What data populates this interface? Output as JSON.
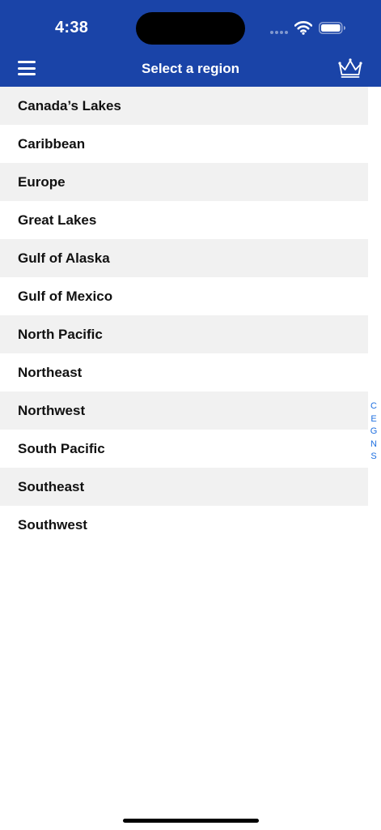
{
  "status_bar": {
    "time": "4:38"
  },
  "header": {
    "title": "Select a region",
    "menu_icon": "hamburger-menu-icon",
    "premium_icon": "crown-icon",
    "background_color": "#1a44a8"
  },
  "regions": [
    {
      "label": "Canada’s Lakes"
    },
    {
      "label": "Caribbean"
    },
    {
      "label": "Europe"
    },
    {
      "label": "Great Lakes"
    },
    {
      "label": "Gulf of Alaska"
    },
    {
      "label": "Gulf of Mexico"
    },
    {
      "label": "North Pacific"
    },
    {
      "label": "Northeast"
    },
    {
      "label": "Northwest"
    },
    {
      "label": "South Pacific"
    },
    {
      "label": "Southeast"
    },
    {
      "label": "Southwest"
    }
  ],
  "section_index": [
    "C",
    "E",
    "G",
    "N",
    "S"
  ],
  "colors": {
    "accent": "#1e6fe0",
    "row_alt": "#f1f1f1"
  }
}
